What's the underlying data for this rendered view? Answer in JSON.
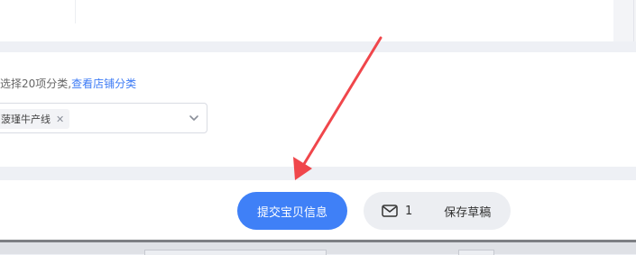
{
  "category": {
    "hint_text": "选择20项分类,",
    "hint_link": "查看店铺分类",
    "selected_tag": "菠瑾牛产线"
  },
  "actions": {
    "submit_label": "提交宝贝信息",
    "message_count": "1",
    "save_draft_label": "保存草稿"
  },
  "icons": {
    "tag_close": "close-icon",
    "select_chevron": "chevron-down-icon",
    "message": "mail-icon",
    "annotation": "red-arrow-annotation"
  },
  "colors": {
    "primary": "#3f80f7",
    "link": "#3d7bf5",
    "annotation_arrow": "#f0464b"
  }
}
